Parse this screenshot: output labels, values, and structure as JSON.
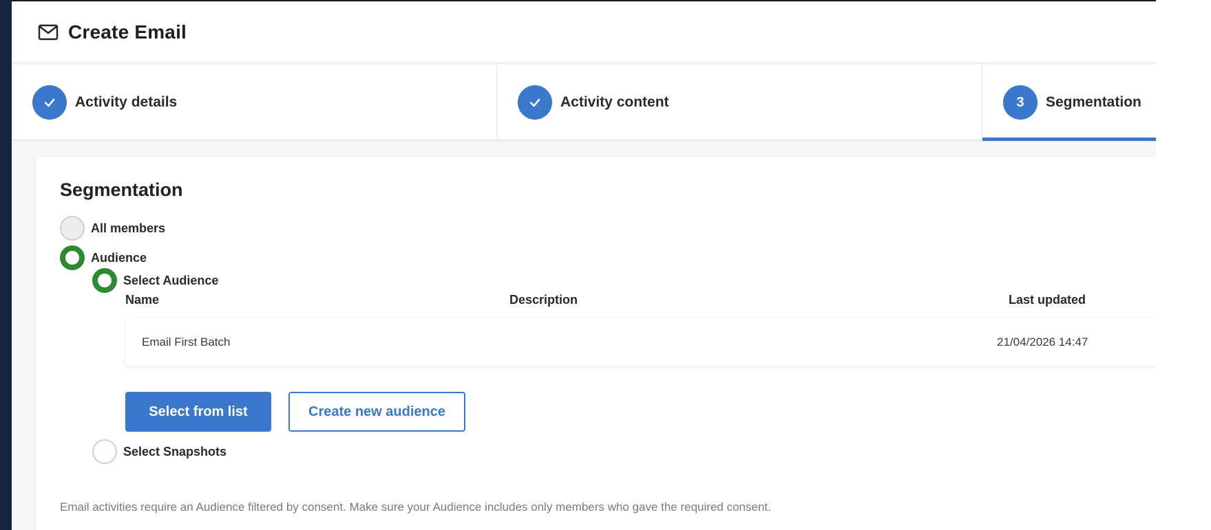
{
  "header": {
    "title": "Create Email",
    "icon": "mail-icon"
  },
  "stepper": {
    "steps": [
      {
        "label": "Activity details",
        "state": "completed",
        "marker": "check-icon"
      },
      {
        "label": "Activity content",
        "state": "completed",
        "marker": "check-icon"
      },
      {
        "label": "Segmentation",
        "state": "active",
        "number": "3"
      }
    ]
  },
  "segmentation": {
    "title": "Segmentation",
    "options": {
      "all_members": {
        "label": "All members",
        "selected": false
      },
      "audience": {
        "label": "Audience",
        "selected": true
      }
    },
    "audience_options": {
      "select_audience": {
        "label": "Select Audience",
        "selected": true
      },
      "select_snapshots": {
        "label": "Select Snapshots",
        "selected": false
      }
    },
    "table": {
      "columns": [
        "Name",
        "Description",
        "Last updated"
      ],
      "rows": [
        {
          "name": "Email First Batch",
          "description": "",
          "last_updated": "21/04/2026 14:47"
        }
      ]
    },
    "buttons": {
      "select_from_list": "Select from list",
      "create_new_audience": "Create new audience"
    },
    "note": "Email activities require an Audience filtered by consent. Make sure your Audience includes only members who gave the required consent."
  },
  "colors": {
    "accent": "#3a78cc",
    "selected_radio": "#2d8a2f",
    "sidebar": "#16253f"
  }
}
